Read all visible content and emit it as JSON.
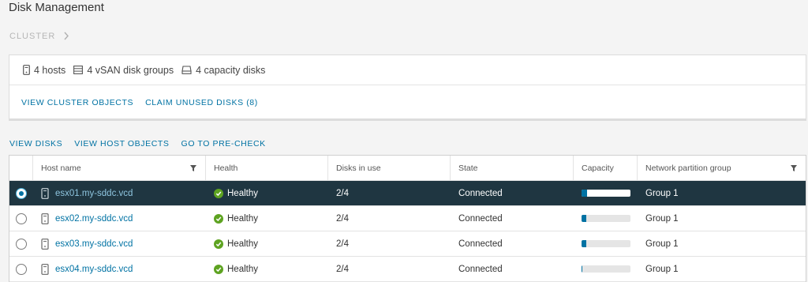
{
  "page": {
    "title": "Disk Management"
  },
  "breadcrumb": {
    "label": "CLUSTER",
    "chevron_icon": "chevron-right-icon"
  },
  "summary": {
    "hosts": "4 hosts",
    "disk_groups": "4 vSAN disk groups",
    "capacity_disks": "4 capacity disks",
    "links": {
      "view_cluster_objects": "VIEW CLUSTER OBJECTS",
      "claim_unused_disks": "CLAIM UNUSED DISKS (8)"
    }
  },
  "actions": {
    "view_disks": "VIEW DISKS",
    "view_host_objects": "VIEW HOST OBJECTS",
    "go_to_precheck": "GO TO PRE-CHECK"
  },
  "table": {
    "headers": {
      "host": "Host name",
      "health": "Health",
      "disks": "Disks in use",
      "state": "State",
      "capacity": "Capacity",
      "group": "Network partition group"
    },
    "rows": [
      {
        "host": "esx01.my-sddc.vcd",
        "health": "Healthy",
        "disks": "2/4",
        "state": "Connected",
        "capacity_fraction": 0.12,
        "group": "Group 1",
        "selected": true
      },
      {
        "host": "esx02.my-sddc.vcd",
        "health": "Healthy",
        "disks": "2/4",
        "state": "Connected",
        "capacity_fraction": 0.1,
        "group": "Group 1",
        "selected": false
      },
      {
        "host": "esx03.my-sddc.vcd",
        "health": "Healthy",
        "disks": "2/4",
        "state": "Connected",
        "capacity_fraction": 0.1,
        "group": "Group 1",
        "selected": false
      },
      {
        "host": "esx04.my-sddc.vcd",
        "health": "Healthy",
        "disks": "2/4",
        "state": "Connected",
        "capacity_fraction": 0.02,
        "group": "Group 1",
        "selected": false
      }
    ]
  },
  "colors": {
    "accent": "#0072a3",
    "selected_row": "#1f3641",
    "healthy": "#5ea321"
  }
}
